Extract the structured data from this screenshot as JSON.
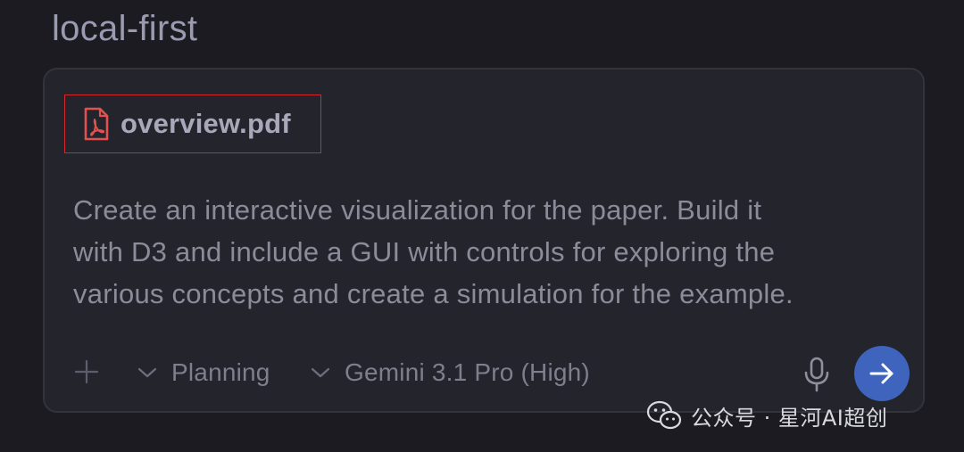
{
  "header": {
    "workspace_title": "local-first"
  },
  "composer": {
    "attachment": {
      "icon": "pdf-file-icon",
      "file_name": "overview.pdf",
      "highlight_color": "#d6262b"
    },
    "prompt_text": "Create an interactive visualization for the paper. Build it\nwith D3 and include a GUI with controls for exploring the\nvarious concepts and create a simulation for the example.",
    "toolbar": {
      "add_icon": "plus-icon",
      "mode_dropdown": {
        "icon": "chevron-down-icon",
        "label": "Planning"
      },
      "model_dropdown": {
        "icon": "chevron-down-icon",
        "label": "Gemini 3.1 Pro (High)"
      },
      "mic_icon": "microphone-icon",
      "send_icon": "arrow-right-icon",
      "send_color": "#3f64bd"
    }
  },
  "watermark": {
    "icon": "wechat-icon",
    "text": "公众号 · 星河AI超创"
  }
}
